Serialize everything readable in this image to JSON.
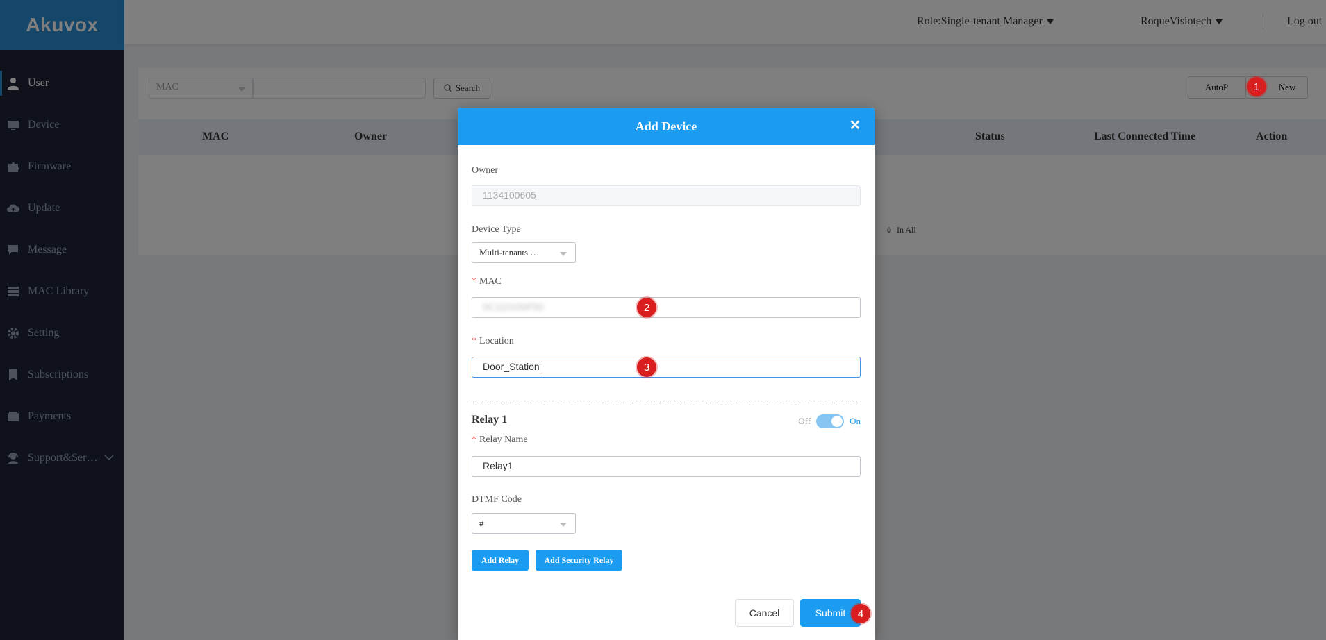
{
  "app": {
    "logo": "Akuvox"
  },
  "sidebar": {
    "items": [
      {
        "label": "User",
        "icon": "user-icon"
      },
      {
        "label": "Device",
        "icon": "device-icon"
      },
      {
        "label": "Firmware",
        "icon": "puzzle-icon"
      },
      {
        "label": "Update",
        "icon": "cloud-upload-icon"
      },
      {
        "label": "Message",
        "icon": "message-icon"
      },
      {
        "label": "MAC Library",
        "icon": "server-icon"
      },
      {
        "label": "Setting",
        "icon": "gear-icon"
      },
      {
        "label": "Subscriptions",
        "icon": "bookmark-icon"
      },
      {
        "label": "Payments",
        "icon": "wallet-icon"
      },
      {
        "label": "Support&Ser…",
        "icon": "support-icon"
      }
    ]
  },
  "header": {
    "role": "Role:Single-tenant Manager",
    "username": "RoqueVisiotech",
    "logout": "Log out"
  },
  "filter": {
    "field": "MAC",
    "search_label": "Search",
    "autop_label": "AutoP",
    "new_label": "New"
  },
  "table": {
    "columns": [
      "MAC",
      "Owner",
      "Status",
      "Last Connected Time",
      "Action"
    ],
    "total": "0",
    "total_label": "In All"
  },
  "modal": {
    "title": "Add Device",
    "owner_label": "Owner",
    "owner_value": "1134100605",
    "device_type_label": "Device Type",
    "device_type_value": "Multi-tenants …",
    "mac_label": "MAC",
    "mac_value": "0C110100F50",
    "location_label": "Location",
    "location_value": "Door_Station",
    "relay_title": "Relay 1",
    "toggle_off": "Off",
    "toggle_on": "On",
    "toggle_state": true,
    "relay_name_label": "Relay Name",
    "relay_name_value": "Relay1",
    "dtmf_label": "DTMF Code",
    "dtmf_value": "#",
    "add_relay": "Add Relay",
    "add_security_relay": "Add Security Relay",
    "cancel": "Cancel",
    "submit": "Submit"
  },
  "markers": [
    "1",
    "2",
    "3",
    "4"
  ],
  "colors": {
    "accent": "#1c9cf0",
    "sidebar": "#1e2535",
    "marker": "#d81e1e"
  }
}
